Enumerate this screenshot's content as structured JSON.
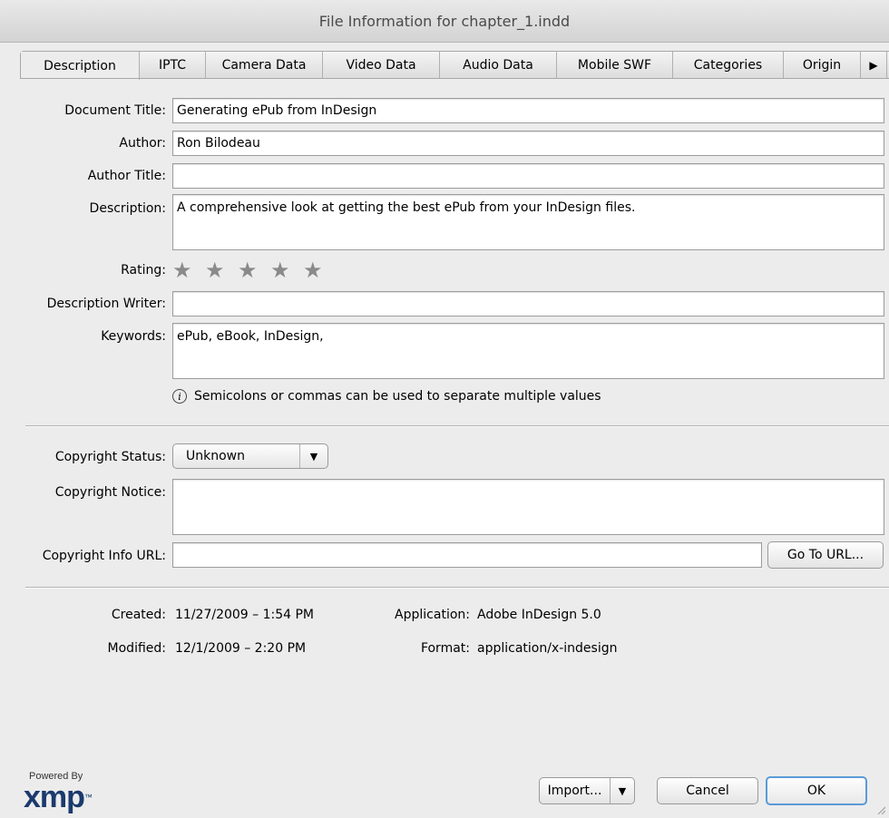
{
  "window": {
    "title": "File Information for chapter_1.indd"
  },
  "tabs": [
    {
      "label": "Description",
      "active": true
    },
    {
      "label": "IPTC"
    },
    {
      "label": "Camera Data"
    },
    {
      "label": "Video Data"
    },
    {
      "label": "Audio Data"
    },
    {
      "label": "Mobile SWF"
    },
    {
      "label": "Categories"
    },
    {
      "label": "Origin"
    }
  ],
  "tab_overflow": {
    "arrow": "▶",
    "menu": "▾"
  },
  "form": {
    "document_title": {
      "label": "Document Title:",
      "value": "Generating ePub from InDesign"
    },
    "author": {
      "label": "Author:",
      "value": "Ron Bilodeau"
    },
    "author_title": {
      "label": "Author Title:",
      "value": ""
    },
    "description": {
      "label": "Description:",
      "value": "A comprehensive look at getting the best ePub from your InDesign files."
    },
    "rating": {
      "label": "Rating:",
      "stars": 0,
      "max": 5,
      "star_glyph": "★"
    },
    "description_writer": {
      "label": "Description Writer:",
      "value": ""
    },
    "keywords": {
      "label": "Keywords:",
      "value": "ePub, eBook, InDesign,"
    },
    "hint": {
      "icon": "i",
      "text": "Semicolons or commas can be used to separate multiple values"
    }
  },
  "copyright": {
    "status": {
      "label": "Copyright Status:",
      "value": "Unknown"
    },
    "notice": {
      "label": "Copyright Notice:",
      "value": ""
    },
    "url": {
      "label": "Copyright Info URL:",
      "value": "",
      "button": "Go To URL..."
    }
  },
  "meta": {
    "created": {
      "label": "Created:",
      "value": "11/27/2009 – 1:54 PM"
    },
    "modified": {
      "label": "Modified:",
      "value": "12/1/2009 – 2:20 PM"
    },
    "application": {
      "label": "Application:",
      "value": "Adobe InDesign 5.0"
    },
    "format": {
      "label": "Format:",
      "value": "application/x-indesign"
    }
  },
  "footer": {
    "powered_by": "Powered By",
    "logo": "xmp",
    "logo_tm": "™",
    "import": "Import...",
    "cancel": "Cancel",
    "ok": "OK"
  },
  "colors": {
    "accent": "#5b9bd8",
    "star": "#8a8a8a",
    "logo": "#1a3a6e"
  }
}
